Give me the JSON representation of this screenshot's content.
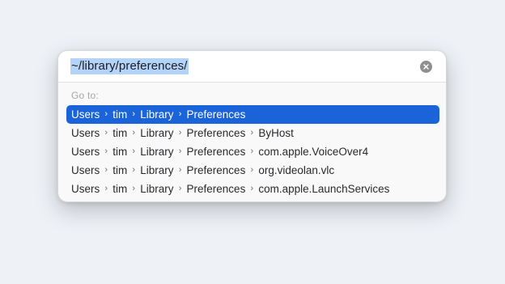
{
  "path_field": {
    "value": "~/library/preferences/"
  },
  "goto_label": "Go to:",
  "separator_glyph": "›",
  "selection_color": "#1a63d8",
  "results": [
    {
      "segments": [
        "Users",
        "tim",
        "Library",
        "Preferences"
      ],
      "selected": true
    },
    {
      "segments": [
        "Users",
        "tim",
        "Library",
        "Preferences",
        "ByHost"
      ],
      "selected": false
    },
    {
      "segments": [
        "Users",
        "tim",
        "Library",
        "Preferences",
        "com.apple.VoiceOver4"
      ],
      "selected": false
    },
    {
      "segments": [
        "Users",
        "tim",
        "Library",
        "Preferences",
        "org.videolan.vlc"
      ],
      "selected": false
    },
    {
      "segments": [
        "Users",
        "tim",
        "Library",
        "Preferences",
        "com.apple.LaunchServices"
      ],
      "selected": false
    }
  ]
}
